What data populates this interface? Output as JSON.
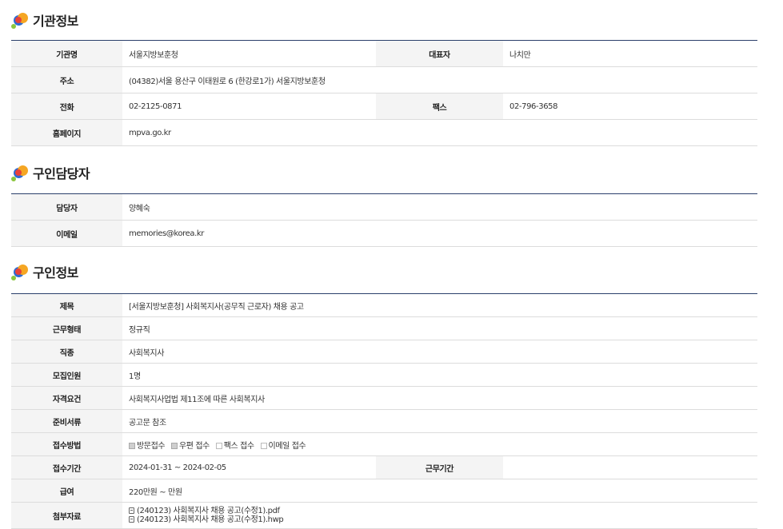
{
  "org": {
    "title": "기관정보",
    "rows": {
      "name_label": "기관명",
      "name": "서울지방보훈청",
      "ceo_label": "대표자",
      "ceo": "나치만",
      "address_label": "주소",
      "address": "(04382)서울 용산구 이태원로 6 (한강로1가) 서울지방보훈청",
      "phone_label": "전화",
      "phone": "02-2125-0871",
      "fax_label": "팩스",
      "fax": "02-796-3658",
      "homepage_label": "홈페이지",
      "homepage": "mpva.go.kr"
    }
  },
  "contact": {
    "title": "구인담당자",
    "rows": {
      "person_label": "담당자",
      "person": "양혜숙",
      "email_label": "이메일",
      "email": "memories@korea.kr"
    }
  },
  "job": {
    "title": "구인정보",
    "rows": {
      "subject_label": "제목",
      "subject": "[서울지방보훈청] 사회복지사(공무직 근로자) 채용 공고",
      "employment_label": "근무형태",
      "employment": "정규직",
      "occupation_label": "직종",
      "occupation": "사회복지사",
      "headcount_label": "모집인원",
      "headcount": "1명",
      "qualification_label": "자격요건",
      "qualification": "사회복지사업법 제11조에 따른 사회복지사",
      "documents_label": "준비서류",
      "documents": "공고문 참조",
      "method_label": "접수방법",
      "methods": [
        {
          "label": "방문접수",
          "checked": true
        },
        {
          "label": "우편 접수",
          "checked": true
        },
        {
          "label": "팩스 접수",
          "checked": false
        },
        {
          "label": "이메일 접수",
          "checked": false
        }
      ],
      "period_label": "접수기간",
      "period": "2024-01-31 ~ 2024-02-05",
      "work_period_label": "근무기간",
      "work_period": "",
      "salary_label": "급여",
      "salary": "220만원 ~ 만원",
      "attachments_label": "첨부자료",
      "attachments": [
        "(240123) 사회복지사 채용 공고(수정1).pdf",
        "(240123) 사회복지사 채용 공고(수정1).hwp"
      ]
    }
  }
}
